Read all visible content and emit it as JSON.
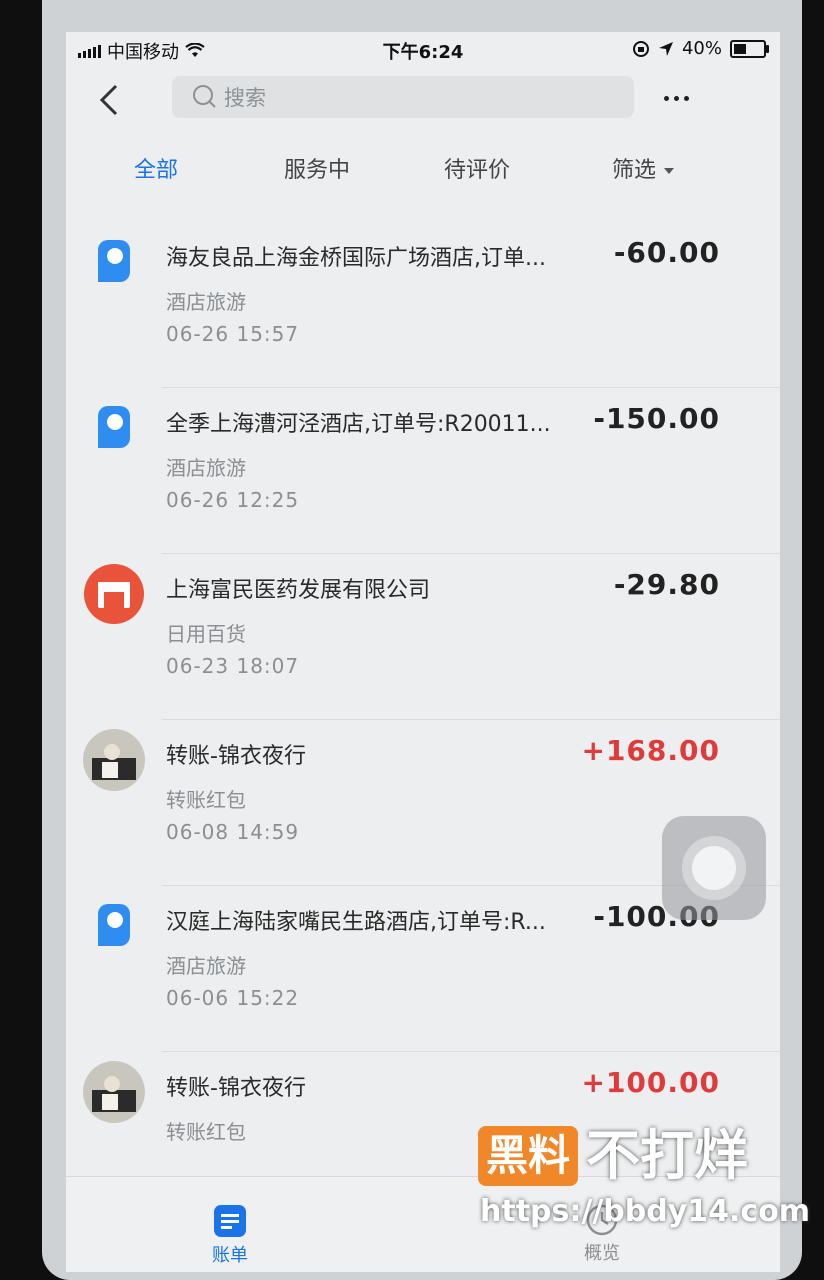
{
  "status_bar": {
    "carrier": "中国移动",
    "time": "下午6:24",
    "battery": "40%"
  },
  "search": {
    "placeholder": "搜索"
  },
  "tabs": [
    {
      "label": "全部",
      "active": true
    },
    {
      "label": "服务中",
      "active": false
    },
    {
      "label": "待评价",
      "active": false
    },
    {
      "label": "筛选",
      "active": false
    }
  ],
  "transactions": [
    {
      "icon": "p-logo-icon",
      "title": "海友良品上海金桥国际广场酒店,订单...",
      "category": "酒店旅游",
      "time": "06-26  15:57",
      "amount": "-60.00"
    },
    {
      "icon": "p-logo-icon",
      "title": "全季上海漕河泾酒店,订单号:R20011...",
      "category": "酒店旅游",
      "time": "06-26  12:25",
      "amount": "-150.00"
    },
    {
      "icon": "store-icon",
      "title": "上海富民医药发展有限公司",
      "category": "日用百货",
      "time": "06-23  18:07",
      "amount": "-29.80"
    },
    {
      "icon": "avatar",
      "title": "转账-锦衣夜行",
      "category": "转账红包",
      "time": "06-08  14:59",
      "amount": "+168.00"
    },
    {
      "icon": "p-logo-icon",
      "title": "汉庭上海陆家嘴民生路酒店,订单号:R...",
      "category": "酒店旅游",
      "time": "06-06  15:22",
      "amount": "-100.00"
    },
    {
      "icon": "avatar",
      "title": "转账-锦衣夜行",
      "category": "转账红包",
      "time": "",
      "amount": "+100.00"
    }
  ],
  "tabbar": [
    {
      "label": "账单",
      "active": true
    },
    {
      "label": "概览",
      "active": false
    }
  ],
  "watermark": {
    "badge": "黑料",
    "text": "不打烊",
    "url": "https://bbdy14.com"
  },
  "colors": {
    "accent": "#1a73e8",
    "income": "#e03a3a",
    "store": "#e8533a",
    "watermark": "#f0882a"
  }
}
